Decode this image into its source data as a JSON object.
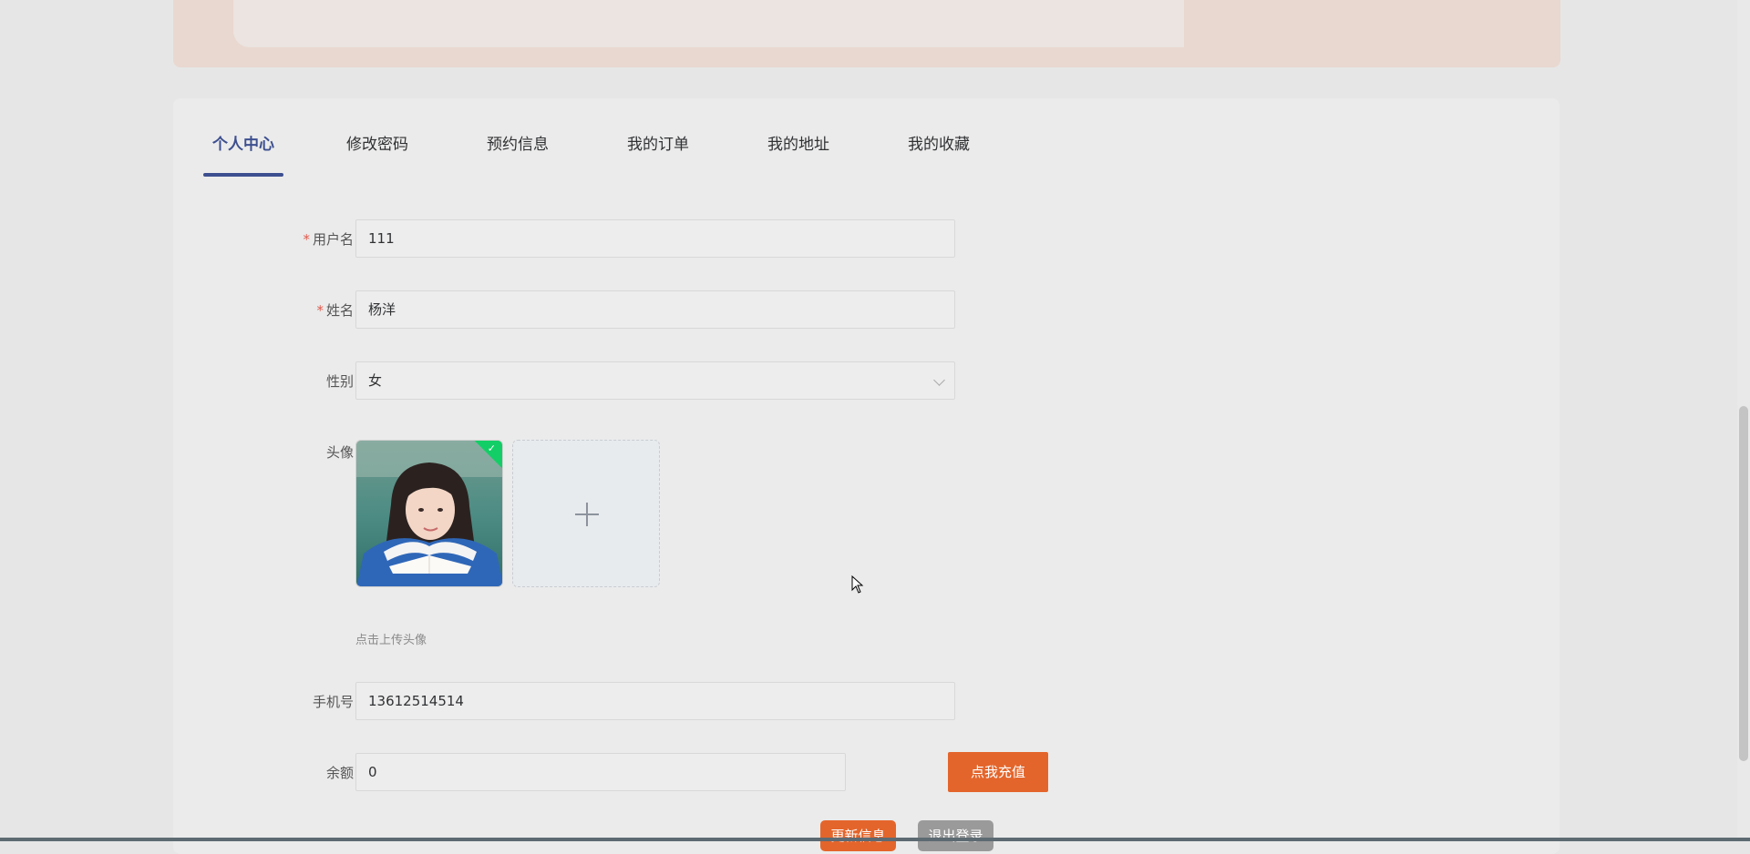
{
  "tabs": [
    {
      "label": "个人中心",
      "active": true
    },
    {
      "label": "修改密码",
      "active": false
    },
    {
      "label": "预约信息",
      "active": false
    },
    {
      "label": "我的订单",
      "active": false
    },
    {
      "label": "我的地址",
      "active": false
    },
    {
      "label": "我的收藏",
      "active": false
    }
  ],
  "form": {
    "username": {
      "label": "用户名",
      "required": true,
      "value": "111"
    },
    "name": {
      "label": "姓名",
      "required": true,
      "value": "杨洋"
    },
    "gender": {
      "label": "性别",
      "value": "女"
    },
    "avatar": {
      "label": "头像",
      "hint": "点击上传头像"
    },
    "phone": {
      "label": "手机号",
      "value": "13612514514"
    },
    "balance": {
      "label": "余额",
      "value": "0",
      "recharge_label": "点我充值"
    }
  },
  "actions": {
    "update_label": "更新信息",
    "logout_label": "退出登录"
  },
  "colors": {
    "accent": "#3d4f8f",
    "button_orange": "#e4652b",
    "button_gray": "#9a9a9a",
    "required": "#e05a4b"
  }
}
